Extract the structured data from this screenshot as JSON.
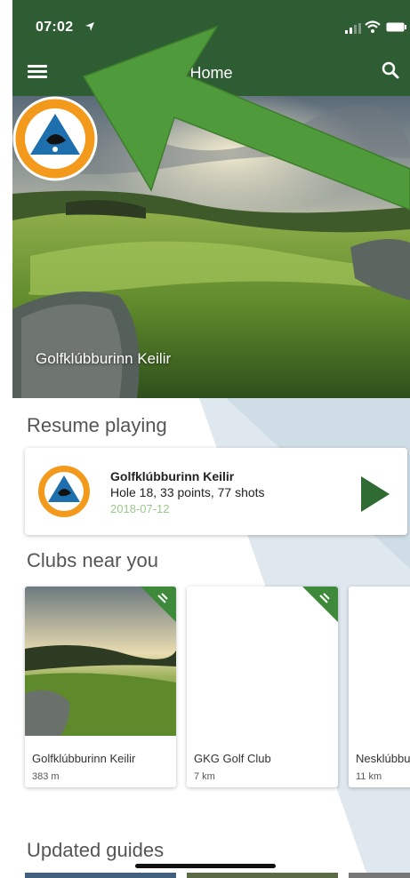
{
  "status": {
    "time": "07:02"
  },
  "header": {
    "title": "Home"
  },
  "hero": {
    "club_name": "Golfklúbburinn Keilir"
  },
  "resume": {
    "section_title": "Resume playing",
    "club": "Golfklúbburinn Keilir",
    "stats": "Hole 18, 33 points, 77 shots",
    "date": "2018-07-12"
  },
  "clubs": {
    "section_title": "Clubs near you",
    "items": [
      {
        "name": "Golfklúbburinn Keilir",
        "distance": "383 m"
      },
      {
        "name": "GKG Golf Club",
        "distance": "7 km"
      },
      {
        "name": "Nesklúbburinn",
        "distance": "11 km"
      }
    ]
  },
  "guides": {
    "section_title": "Updated guides"
  },
  "colors": {
    "header_green": "#2e5c33",
    "play_green": "#2f6b33",
    "date_green": "#9ac98a",
    "arrow_green": "#4f9a3a"
  },
  "icons": {
    "status": [
      "location-arrow-icon",
      "signal-icon",
      "wifi-icon",
      "battery-icon"
    ],
    "header": [
      "menu-icon",
      "search-icon"
    ],
    "resume": [
      "club-logo-icon",
      "play-icon"
    ],
    "clubs": [
      "ribbon-icon"
    ]
  }
}
